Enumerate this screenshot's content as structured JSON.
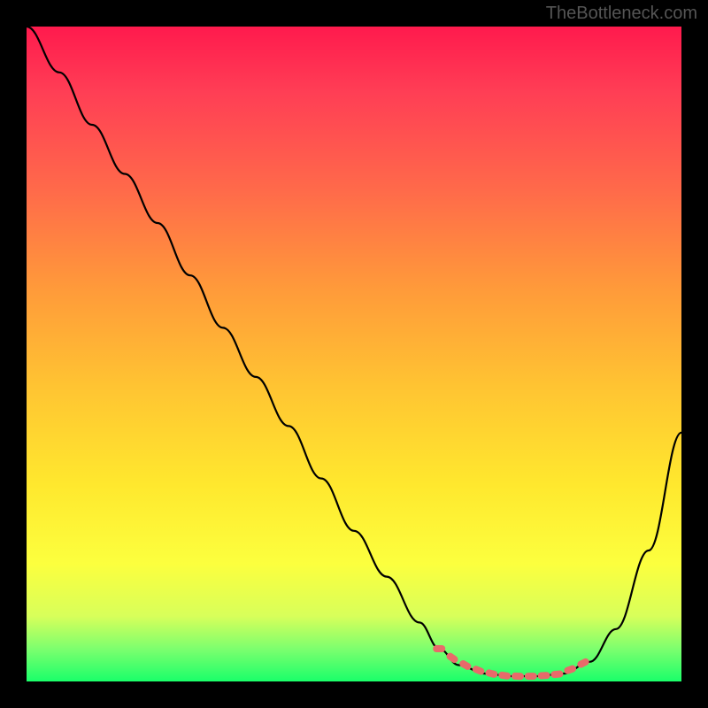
{
  "watermark": "TheBottleneck.com",
  "chart_data": {
    "type": "line",
    "title": "",
    "xlabel": "",
    "ylabel": "",
    "xlim": [
      0,
      100
    ],
    "ylim": [
      0,
      100
    ],
    "series": [
      {
        "name": "bottleneck-curve",
        "x": [
          0,
          5,
          10,
          15,
          20,
          25,
          30,
          35,
          40,
          45,
          50,
          55,
          60,
          63,
          66,
          70,
          74,
          78,
          82,
          86,
          90,
          95,
          100
        ],
        "values": [
          100,
          93,
          85,
          77.5,
          70,
          62,
          54,
          46.5,
          39,
          31,
          23,
          16,
          9,
          5,
          2.5,
          1.2,
          0.8,
          0.8,
          1.2,
          3,
          8,
          20,
          38
        ]
      }
    ],
    "markers": {
      "name": "dotted-region",
      "x": [
        63,
        65,
        67,
        69,
        71,
        73,
        75,
        77,
        79,
        81,
        83,
        85
      ],
      "values": [
        5.0,
        3.6,
        2.5,
        1.7,
        1.2,
        0.9,
        0.8,
        0.8,
        0.9,
        1.1,
        1.8,
        2.8
      ]
    },
    "gradient_stops": [
      {
        "pos": 0,
        "color": "#ff1a4d"
      },
      {
        "pos": 10,
        "color": "#ff3e55"
      },
      {
        "pos": 25,
        "color": "#ff6a4a"
      },
      {
        "pos": 40,
        "color": "#ff9a3a"
      },
      {
        "pos": 55,
        "color": "#ffc432"
      },
      {
        "pos": 70,
        "color": "#ffe82e"
      },
      {
        "pos": 82,
        "color": "#fcff3e"
      },
      {
        "pos": 90,
        "color": "#d8ff5a"
      },
      {
        "pos": 95,
        "color": "#7dff6e"
      },
      {
        "pos": 100,
        "color": "#1aff6a"
      }
    ],
    "marker_color": "#e86a6a",
    "curve_color": "#000000"
  }
}
